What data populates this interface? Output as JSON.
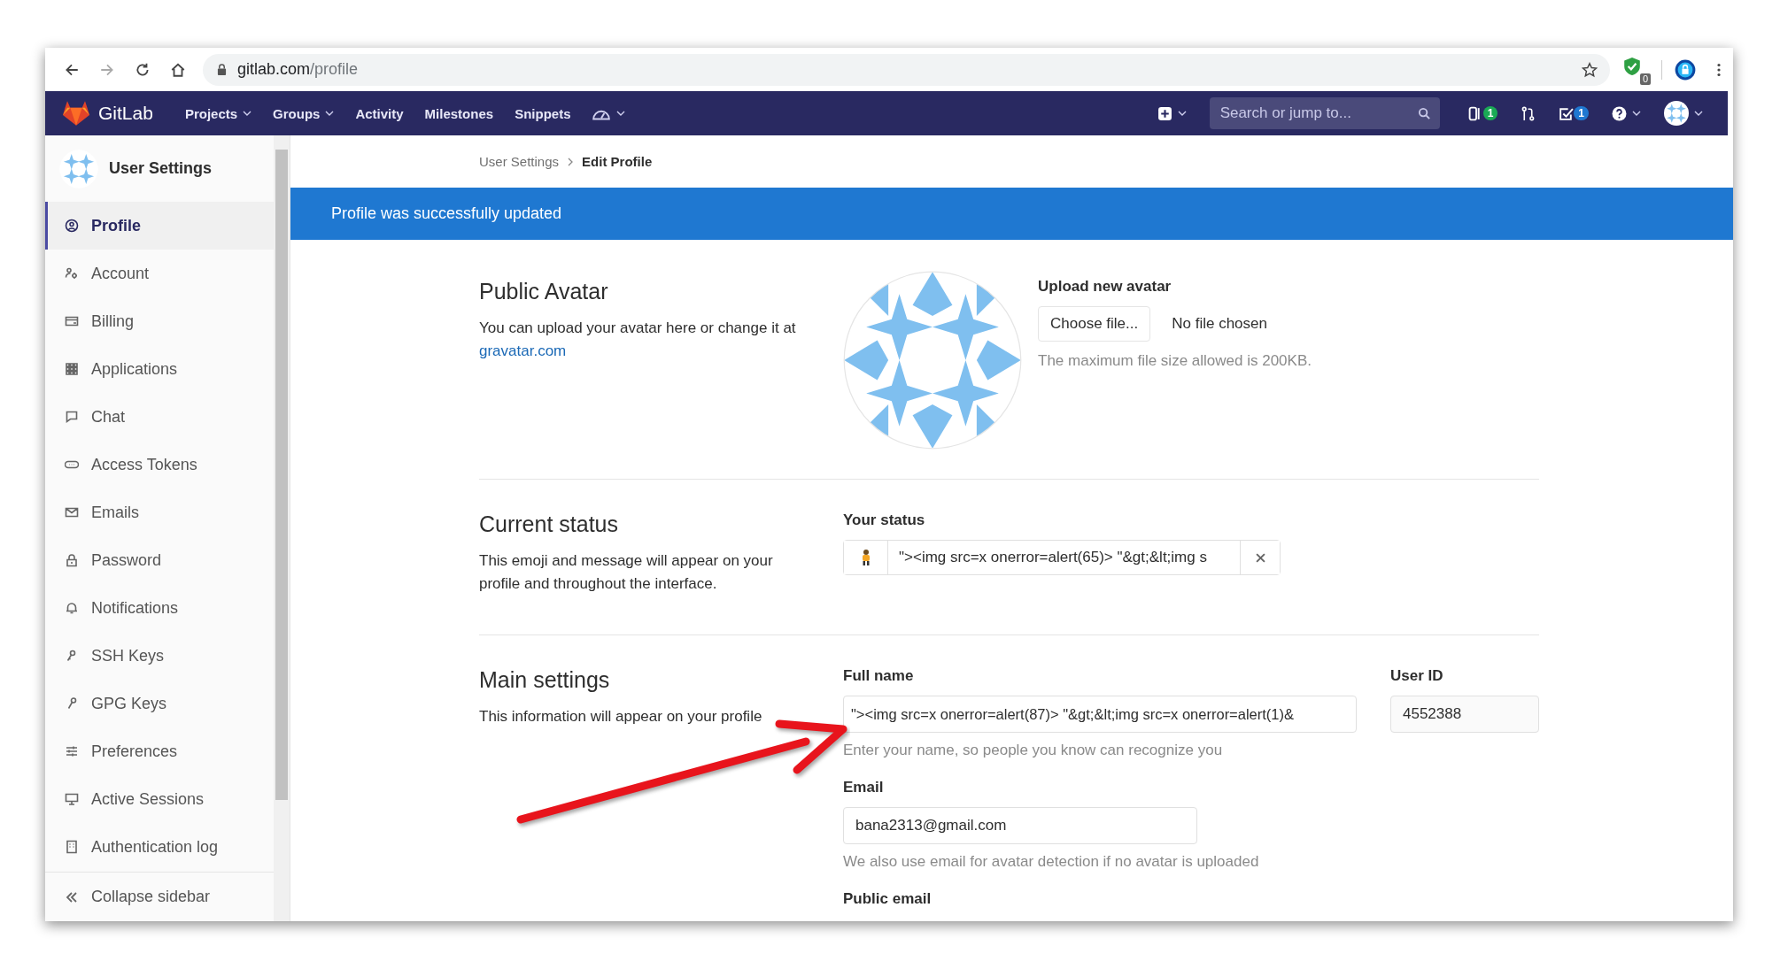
{
  "browser": {
    "host": "gitlab.com",
    "path": "/profile",
    "extension_badge": "0"
  },
  "navbar": {
    "brand": "GitLab",
    "menu": [
      {
        "label": "Projects",
        "dropdown": true
      },
      {
        "label": "Groups",
        "dropdown": true
      },
      {
        "label": "Activity",
        "dropdown": false
      },
      {
        "label": "Milestones",
        "dropdown": false
      },
      {
        "label": "Snippets",
        "dropdown": false
      }
    ],
    "search_placeholder": "Search or jump to...",
    "issues_count": "1",
    "todos_count": "1"
  },
  "sidebar": {
    "title": "User Settings",
    "items": [
      {
        "label": "Profile",
        "selected": true
      },
      {
        "label": "Account",
        "selected": false
      },
      {
        "label": "Billing",
        "selected": false
      },
      {
        "label": "Applications",
        "selected": false
      },
      {
        "label": "Chat",
        "selected": false
      },
      {
        "label": "Access Tokens",
        "selected": false
      },
      {
        "label": "Emails",
        "selected": false
      },
      {
        "label": "Password",
        "selected": false
      },
      {
        "label": "Notifications",
        "selected": false
      },
      {
        "label": "SSH Keys",
        "selected": false
      },
      {
        "label": "GPG Keys",
        "selected": false
      },
      {
        "label": "Preferences",
        "selected": false
      },
      {
        "label": "Active Sessions",
        "selected": false
      },
      {
        "label": "Authentication log",
        "selected": false
      }
    ],
    "collapse": "Collapse sidebar"
  },
  "breadcrumb": {
    "parent": "User Settings",
    "current": "Edit Profile"
  },
  "flash": "Profile was successfully updated",
  "avatar_section": {
    "title": "Public Avatar",
    "description": "You can upload your avatar here or change it at",
    "link": "gravatar.com",
    "upload_label": "Upload new avatar",
    "choose_button": "Choose file...",
    "no_file": "No file chosen",
    "hint": "The maximum file size allowed is 200KB."
  },
  "status_section": {
    "title": "Current status",
    "description": "This emoji and message will appear on your profile and throughout the interface.",
    "label": "Your status",
    "value": "\"><img src=x onerror=alert(65)> \"&gt;&lt;img s"
  },
  "main_section": {
    "title": "Main settings",
    "description": "This information will appear on your profile",
    "full_name": {
      "label": "Full name",
      "value": "\"><img src=x onerror=alert(87)> \"&gt;&lt;img src=x onerror=alert(1)&",
      "hint": "Enter your name, so people you know can recognize you"
    },
    "user_id": {
      "label": "User ID",
      "value": "4552388"
    },
    "email": {
      "label": "Email",
      "value": "bana2313@gmail.com",
      "hint": "We also use email for avatar detection if no avatar is uploaded"
    },
    "public_email_label": "Public email"
  }
}
